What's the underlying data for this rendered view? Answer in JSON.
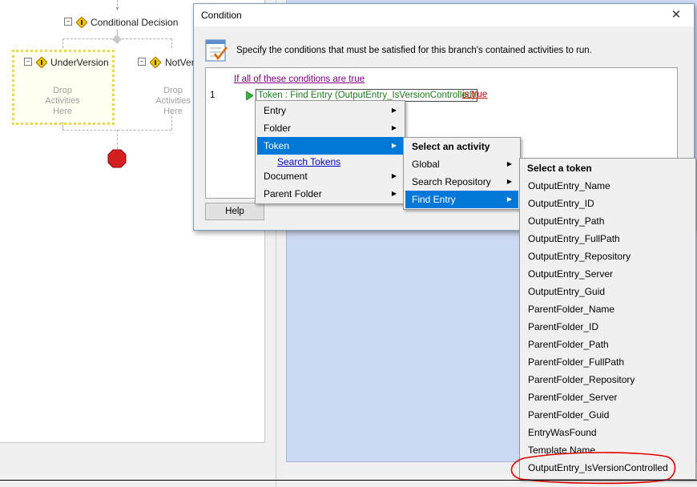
{
  "workflow": {
    "conditional_decision_label": "Conditional Decision",
    "branch_left_label": "UnderVersion",
    "branch_right_label": "NotVer",
    "drop_left": [
      "Drop",
      "Activities",
      "Here"
    ],
    "drop_right": [
      "Drop",
      "Activities",
      "Here"
    ]
  },
  "dialog": {
    "title": "Condition",
    "close_glyph": "✕",
    "instruction": "Specify the conditions that must be satisfied for this branch's contained activities to run.",
    "header_link": "If all of these conditions are true",
    "line_number": "1",
    "token_text": "Token : Find Entry (OutputEntry_IsVersionControlled)",
    "is_true_link": "is true",
    "help_label": "Help"
  },
  "menu1": {
    "items": [
      "Entry",
      "Folder",
      "Token",
      "Search Tokens",
      "Document",
      "Parent Folder"
    ],
    "selected": "Token"
  },
  "menu2": {
    "header": "Select an activity",
    "items": [
      "Global",
      "Search Repository",
      "Find Entry"
    ],
    "selected": "Find Entry"
  },
  "menu3": {
    "header": "Select a token",
    "items": [
      "OutputEntry_Name",
      "OutputEntry_ID",
      "OutputEntry_Path",
      "OutputEntry_FullPath",
      "OutputEntry_Repository",
      "OutputEntry_Server",
      "OutputEntry_Guid",
      "ParentFolder_Name",
      "ParentFolder_ID",
      "ParentFolder_Path",
      "ParentFolder_FullPath",
      "ParentFolder_Repository",
      "ParentFolder_Server",
      "ParentFolder_Guid",
      "EntryWasFound",
      "Template Name",
      "OutputEntry_IsVersionControlled"
    ]
  },
  "colors": {
    "selection": "#0078d7",
    "annotation_circle": "#e00000",
    "token_green": "#1a7f1a",
    "stop_red": "#d42020"
  }
}
